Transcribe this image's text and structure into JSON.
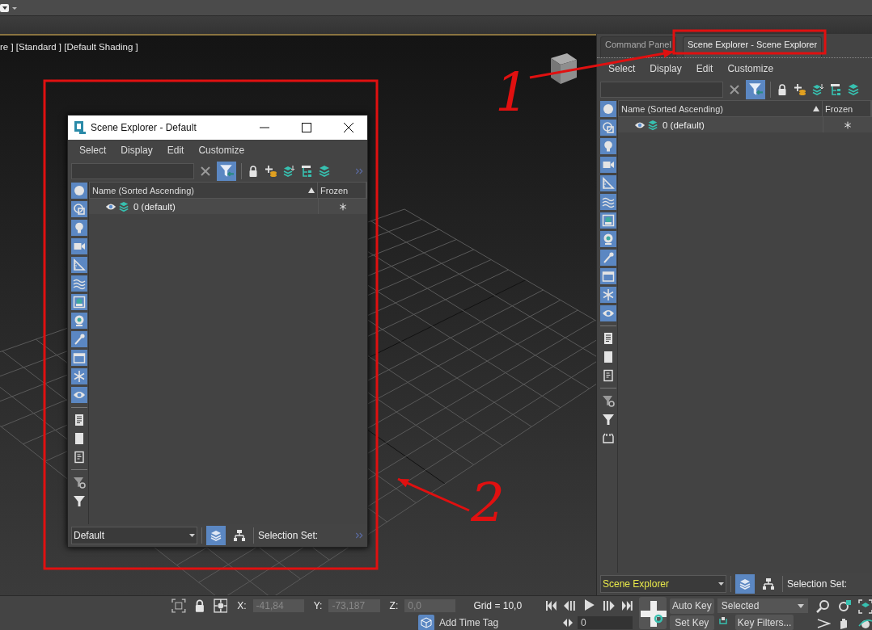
{
  "viewport": {
    "label": "re ] [Standard ] [Default Shading ]"
  },
  "scene_explorer_window": {
    "title": "Scene Explorer - Default",
    "menu": [
      "Select",
      "Display",
      "Edit",
      "Customize"
    ],
    "filter_toggle": {
      "selected": true
    },
    "columns": [
      "Name (Sorted Ascending)",
      "Frozen"
    ],
    "rows": [
      {
        "name": "0 (default)"
      }
    ],
    "type_filters": [
      {
        "kind": "sphere",
        "selected": true
      },
      {
        "kind": "shapes",
        "selected": true
      },
      {
        "kind": "bulb",
        "selected": true
      },
      {
        "kind": "camera",
        "selected": true
      },
      {
        "kind": "ruler",
        "selected": true
      },
      {
        "kind": "waves",
        "selected": true
      },
      {
        "kind": "frame",
        "selected": true
      },
      {
        "kind": "pin",
        "selected": true
      },
      {
        "kind": "wand",
        "selected": true
      },
      {
        "kind": "drawer",
        "selected": true
      },
      {
        "kind": "snowflake",
        "selected": true
      },
      {
        "kind": "eye",
        "selected": true
      },
      {
        "kind": "separator"
      },
      {
        "kind": "list-page",
        "selected": false
      },
      {
        "kind": "blank-page",
        "selected": false
      },
      {
        "kind": "outline-page",
        "selected": false
      },
      {
        "kind": "separator"
      },
      {
        "kind": "filter-gear",
        "selected": false
      },
      {
        "kind": "filter",
        "selected": false
      }
    ],
    "explorer_name": "Default",
    "view_modes": [
      {
        "kind": "layers",
        "selected": true
      },
      {
        "kind": "hierarchy",
        "selected": false
      }
    ],
    "selection_set_label": "Selection Set:"
  },
  "dock_panel": {
    "tabs": [
      {
        "label": "Command Panel",
        "selected": false
      },
      {
        "label": "Scene Explorer - Scene Explorer",
        "selected": true
      }
    ],
    "menu": [
      "Select",
      "Display",
      "Edit",
      "Customize"
    ],
    "filter_toggle": {
      "selected": true
    },
    "columns": [
      "Name (Sorted Ascending)",
      "Frozen"
    ],
    "rows": [
      {
        "name": "0 (default)"
      }
    ],
    "type_filters": [
      {
        "kind": "sphere",
        "selected": true
      },
      {
        "kind": "shapes",
        "selected": true
      },
      {
        "kind": "bulb",
        "selected": true
      },
      {
        "kind": "camera",
        "selected": true
      },
      {
        "kind": "ruler",
        "selected": true
      },
      {
        "kind": "waves",
        "selected": true
      },
      {
        "kind": "frame",
        "selected": true
      },
      {
        "kind": "pin",
        "selected": true
      },
      {
        "kind": "wand",
        "selected": true
      },
      {
        "kind": "drawer",
        "selected": true
      },
      {
        "kind": "snowflake",
        "selected": true
      },
      {
        "kind": "eye",
        "selected": true
      },
      {
        "kind": "separator"
      },
      {
        "kind": "list-page",
        "selected": false
      },
      {
        "kind": "blank-page",
        "selected": false
      },
      {
        "kind": "outline-page",
        "selected": false
      },
      {
        "kind": "separator"
      },
      {
        "kind": "filter-gear",
        "selected": false
      },
      {
        "kind": "filter",
        "selected": false
      },
      {
        "kind": "tray",
        "selected": false
      }
    ],
    "explorer_name": "Scene Explorer",
    "view_modes": [
      {
        "kind": "layers",
        "selected": true
      },
      {
        "kind": "hierarchy",
        "selected": false
      }
    ],
    "selection_set_label": "Selection Set:"
  },
  "status_bar": {
    "coordinates": [
      {
        "axis": "X:",
        "value": "-41,84"
      },
      {
        "axis": "Y:",
        "value": "-73,187"
      },
      {
        "axis": "Z:",
        "value": "0,0"
      }
    ],
    "grid": "Grid = 10,0",
    "time_tag": "Add Time Tag",
    "frame": "0",
    "auto_key": "Auto Key",
    "set_key": "Set Key",
    "key_mode": "Selected",
    "key_filters": "Key Filters..."
  },
  "annotations": [
    {
      "label": "1"
    },
    {
      "label": "2"
    }
  ]
}
